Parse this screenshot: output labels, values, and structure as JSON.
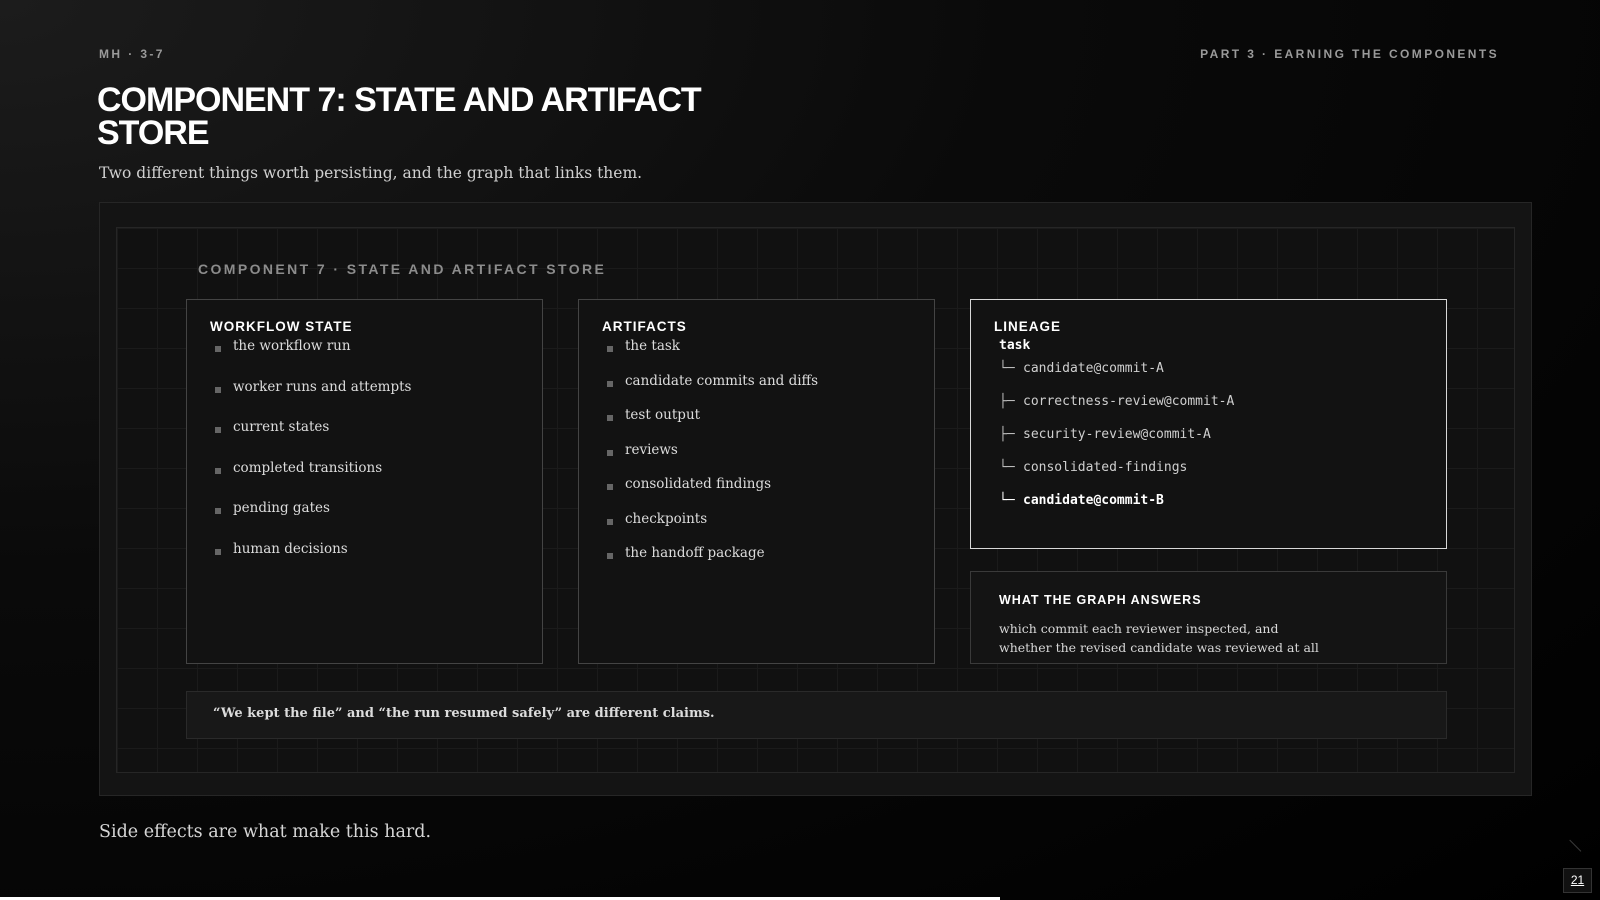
{
  "header": {
    "left_kicker": "MH · 3-7",
    "right_kicker": "PART 3 · EARNING THE COMPONENTS",
    "title": "COMPONENT 7: STATE AND ARTIFACT STORE",
    "subtitle": "Two different things worth persisting, and the graph that links them."
  },
  "diagram": {
    "heading": "COMPONENT 7 · STATE AND ARTIFACT STORE",
    "workflow_state": {
      "title": "WORKFLOW STATE",
      "items": [
        "the workflow run",
        "worker runs and attempts",
        "current states",
        "completed transitions",
        "pending gates",
        "human decisions"
      ]
    },
    "artifacts": {
      "title": "ARTIFACTS",
      "items": [
        "the task",
        "candidate commits and diffs",
        "test output",
        "reviews",
        "consolidated findings",
        "checkpoints",
        "the handoff package"
      ]
    },
    "lineage": {
      "title": "LINEAGE",
      "root": "task",
      "nodes": [
        {
          "glyph": "└─",
          "label": "candidate@commit-A"
        },
        {
          "glyph": "├─",
          "label": "correctness-review@commit-A"
        },
        {
          "glyph": "├─",
          "label": "security-review@commit-A"
        },
        {
          "glyph": "└─",
          "label": "consolidated-findings"
        },
        {
          "glyph": "└─",
          "label": "candidate@commit-B"
        }
      ]
    },
    "graph_answers": {
      "title": "WHAT THE GRAPH ANSWERS",
      "text": "which commit each reviewer inspected, and whether the revised candidate was reviewed at all"
    },
    "quote": "“We kept the file” and “the run resumed safely” are different claims."
  },
  "footer": {
    "note": "Side effects are what make this hard.",
    "page_number": "21",
    "progress": 0.625
  },
  "colors": {
    "background": "#000000",
    "panel": "#141414",
    "accent": "#ffffff",
    "bullet": "#666666"
  }
}
